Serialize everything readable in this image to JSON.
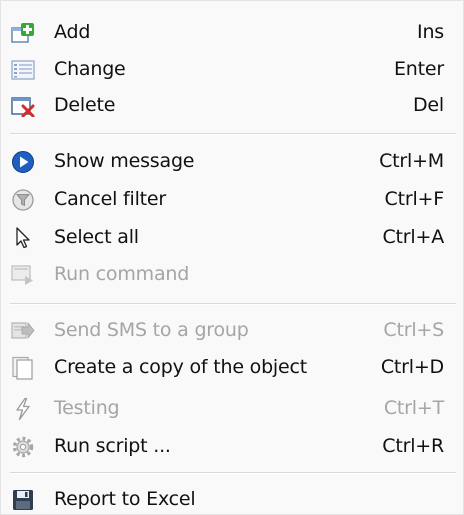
{
  "menu": {
    "items": [
      {
        "label": "Add",
        "shortcut": "Ins",
        "icon": "add-icon",
        "enabled": true
      },
      {
        "label": "Change",
        "shortcut": "Enter",
        "icon": "list-icon",
        "enabled": true
      },
      {
        "label": "Delete",
        "shortcut": "Del",
        "icon": "delete-icon",
        "enabled": true
      },
      {
        "label": "Show message",
        "shortcut": "Ctrl+M",
        "icon": "play-icon",
        "enabled": true
      },
      {
        "label": "Cancel filter",
        "shortcut": "Ctrl+F",
        "icon": "cancel-filter-icon",
        "enabled": true
      },
      {
        "label": "Select all",
        "shortcut": "Ctrl+A",
        "icon": "cursor-icon",
        "enabled": true
      },
      {
        "label": "Run command",
        "shortcut": "",
        "icon": "run-command-icon",
        "enabled": false
      },
      {
        "label": "Send SMS to a group",
        "shortcut": "Ctrl+S",
        "icon": "send-sms-icon",
        "enabled": false
      },
      {
        "label": "Create a copy of the object",
        "shortcut": "Ctrl+D",
        "icon": "copy-icon",
        "enabled": true
      },
      {
        "label": "Testing",
        "shortcut": "Ctrl+T",
        "icon": "lightning-icon",
        "enabled": false
      },
      {
        "label": "Run script ...",
        "shortcut": "Ctrl+R",
        "icon": "gear-icon",
        "enabled": true
      },
      {
        "label": "Report to Excel",
        "shortcut": "",
        "icon": "save-icon",
        "enabled": true
      }
    ]
  }
}
